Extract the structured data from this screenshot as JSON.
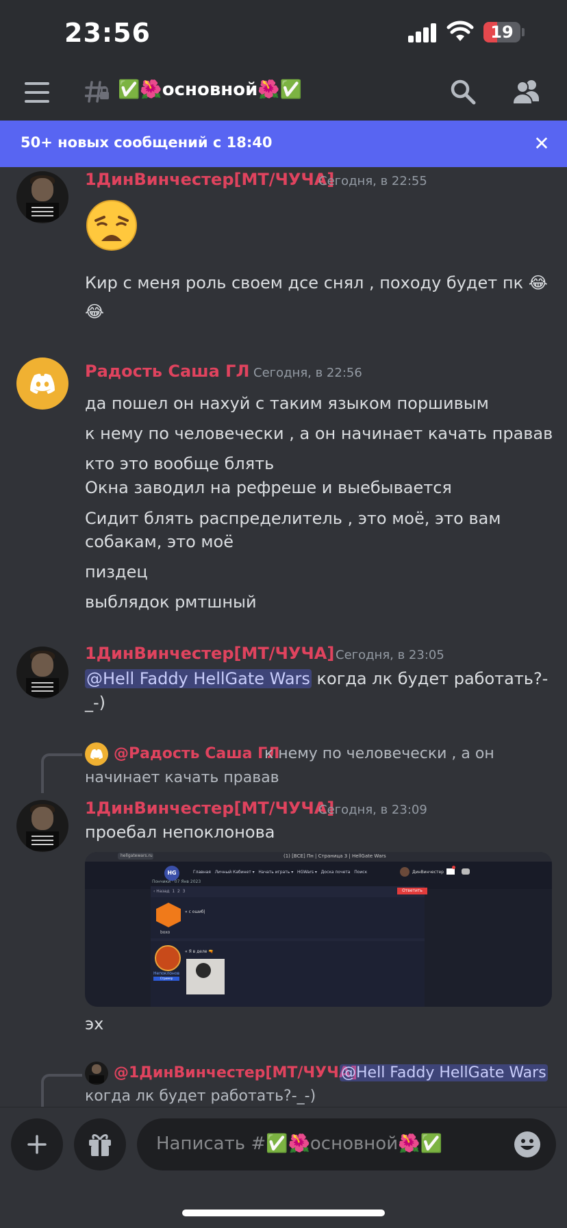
{
  "status_bar": {
    "time": "23:56",
    "battery": "19"
  },
  "header": {
    "channel_name": "✅🌺основной🌺✅",
    "icons": [
      "menu-icon",
      "locked-channel-icon",
      "search-icon",
      "members-icon"
    ]
  },
  "banner": {
    "text": "50+ новых сообщений с 18:40",
    "close": "✕"
  },
  "messages": [
    {
      "author": "1ДинВинчестер[МТ/ЧУЧА]",
      "time": "Сегодня, в 22:55",
      "big_emoji": "weary-face",
      "lines": [
        "Кир с меня роль своем дсе снял , походу будет пк 😂",
        "😂"
      ]
    },
    {
      "author": "Радость Саша ГЛ",
      "time": "Сегодня, в 22:56",
      "lines": [
        "да пошел он нахуй с таким языком поршивым",
        "к нему по человечески , а он начинает качать правав",
        "кто это вообще блять",
        "Окна заводил на рефреше и выебывается",
        "Сидит блять распределитель , это моё, это вам",
        "собакам, это моё",
        "пиздец",
        "выблядок рмтшный"
      ]
    },
    {
      "author": "1ДинВинчестер[МТ/ЧУЧА]",
      "time": "Сегодня, в 23:05",
      "mention": "@Hell Faddy HellGate Wars",
      "lines": [
        " когда лк будет работать?-",
        "_-)"
      ]
    },
    {
      "reply": {
        "name": "@Радость Саша ГЛ",
        "text1": " к нему по человечески , а он",
        "text2": "начинает качать правав"
      },
      "author": "1ДинВинчестер[МТ/ЧУЧА]",
      "time": "Сегодня, в 23:09",
      "lines": [
        "проебал непоклонова",
        "эх"
      ],
      "attachment": {
        "tab": "(1) [ВСЕ] Пн | Страница 3 | HellGate Wars",
        "url": "hellgatewars.ru",
        "logo": "HG",
        "nav": [
          "Главная",
          "Личный Кабинет ▾",
          "Начать играть ▾",
          "HGWars ▾",
          "Доска почета",
          "Поиск"
        ],
        "user": "ДинВинчестер",
        "breadcrumb": "Пончики  · 07 Янв 2023",
        "pages": [
          "1",
          "2",
          "3"
        ],
        "reply_btn": "Ответить",
        "post1_user": "boxo",
        "post1_text": "« с ошиб|",
        "post2_user": "Непоклонов",
        "post2_role": "Стример",
        "post2_text": "« Я в деле 🔫"
      }
    },
    {
      "reply": {
        "name": "@1ДинВинчестер[МТ/ЧУЧА]",
        "mention": "@Hell Faddy HellGate Wars",
        "text2": "когда лк будет работать?-_-)"
      }
    }
  ],
  "composer": {
    "placeholder": "Написать #✅🌺основной🌺✅",
    "add": "+",
    "icons": [
      "plus-icon",
      "gift-icon",
      "emoji-icon"
    ]
  },
  "colors": {
    "background": "#313338",
    "header": "#2b2d31",
    "accent": "#5865f2",
    "username": "#e0435e"
  }
}
